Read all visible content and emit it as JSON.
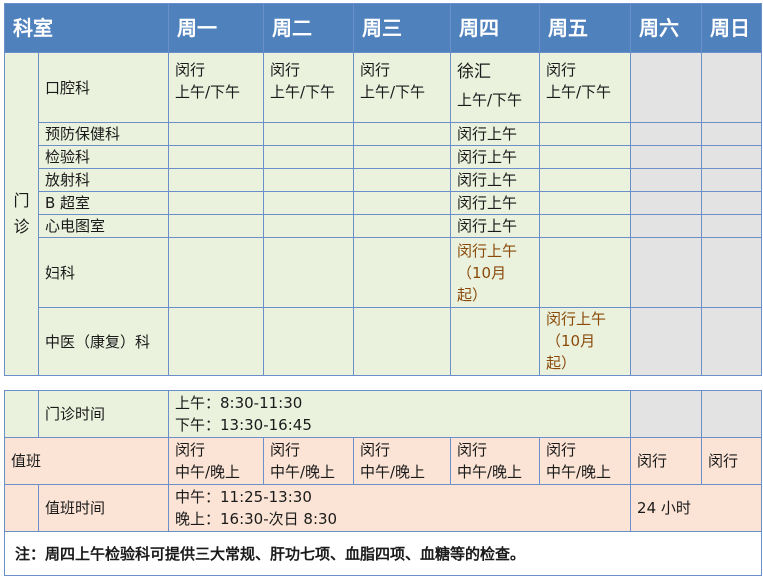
{
  "header": [
    "科室",
    "周一",
    "周二",
    "周三",
    "周四",
    "周五",
    "周六",
    "周日"
  ],
  "clinic": {
    "group_label_1": "门",
    "group_label_2": "诊",
    "kouqiang": {
      "name": "口腔科",
      "mon_1": "闵行",
      "mon_2": "上午/下午",
      "tue_1": "闵行",
      "tue_2": "上午/下午",
      "wed_1": "闵行",
      "wed_2": "上午/下午",
      "thu_1": "徐汇",
      "thu_2": "上午/下午",
      "fri_1": "闵行",
      "fri_2": "上午/下午"
    },
    "rows": [
      {
        "name": "预防保健科",
        "thu": "闵行上午"
      },
      {
        "name": "检验科",
        "thu": "闵行上午"
      },
      {
        "name": "放射科",
        "thu": "闵行上午"
      },
      {
        "name": "B 超室",
        "thu": "闵行上午"
      },
      {
        "name": "心电图室",
        "thu": "闵行上午"
      }
    ],
    "fuke": {
      "name": "妇科",
      "thu_1": "闵行上午",
      "thu_2": "（10月",
      "thu_3": "起）"
    },
    "zhongyi": {
      "name": "中医（康复）科",
      "fri_1": "闵行上午",
      "fri_2": "（10月",
      "fri_3": "起）"
    }
  },
  "clinic_hours": {
    "label": "门诊时间",
    "line_1": "上午：8:30-11:30",
    "line_2": "下午：13:30-16:45"
  },
  "duty": {
    "label": "值班",
    "cell_1": "闵行",
    "cell_2": "中午/晚上",
    "sat": "闵行",
    "sun": "闵行"
  },
  "duty_hours": {
    "label": "值班时间",
    "line_1": "中午：11:25-13:30",
    "line_2": "晚上：16:30-次日 8:30",
    "weekend": "24 小时"
  },
  "note": "注：周四上午检验科可提供三大常规、肝功七项、血脂四项、血糖等的检查。",
  "colors": {
    "header_blue": "#4f81bd",
    "clinic_green": "#eaf1dd",
    "weekend_gray": "#e3e3e3",
    "duty_peach": "#fbe4d5",
    "note_brown": "#8a4a0a",
    "border_blue": "#6b8fc8"
  }
}
